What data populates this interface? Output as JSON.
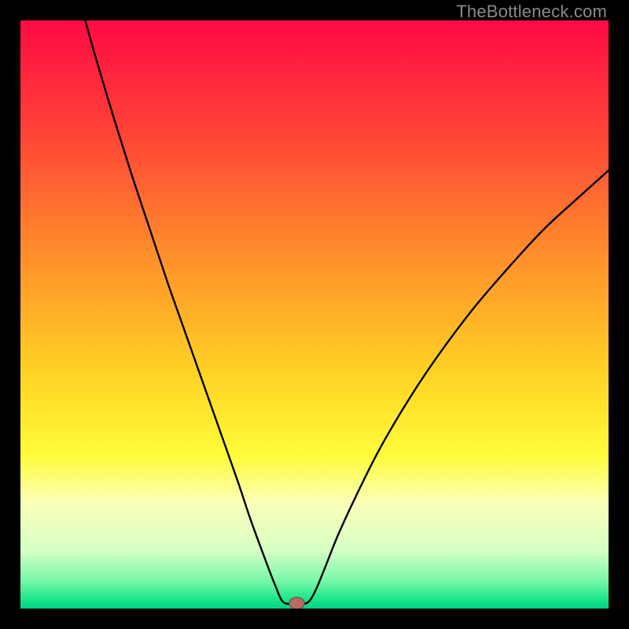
{
  "watermark": "TheBottleneck.com",
  "chart_data": {
    "type": "line",
    "title": "",
    "xlabel": "",
    "ylabel": "",
    "xlim": [
      0,
      100
    ],
    "ylim": [
      0,
      100
    ],
    "background_gradient": {
      "stops": [
        {
          "offset": 0.0,
          "color": "#ff0b44"
        },
        {
          "offset": 0.18,
          "color": "#ff3f37"
        },
        {
          "offset": 0.4,
          "color": "#ff8f2b"
        },
        {
          "offset": 0.6,
          "color": "#ffd324"
        },
        {
          "offset": 0.74,
          "color": "#fffc3a"
        },
        {
          "offset": 0.82,
          "color": "#faffb8"
        },
        {
          "offset": 0.9,
          "color": "#d7ffc4"
        },
        {
          "offset": 0.95,
          "color": "#7ef8ab"
        },
        {
          "offset": 0.985,
          "color": "#18e588"
        },
        {
          "offset": 1.0,
          "color": "#00d084"
        }
      ]
    },
    "series": [
      {
        "name": "bottleneck-curve",
        "color": "#000000",
        "stroke_width": 2.4,
        "points": [
          {
            "x": 11.0,
            "y": 100.0
          },
          {
            "x": 13.0,
            "y": 93.0
          },
          {
            "x": 16.0,
            "y": 83.0
          },
          {
            "x": 19.0,
            "y": 73.5
          },
          {
            "x": 22.0,
            "y": 64.5
          },
          {
            "x": 25.0,
            "y": 55.5
          },
          {
            "x": 28.0,
            "y": 47.0
          },
          {
            "x": 31.0,
            "y": 38.5
          },
          {
            "x": 34.0,
            "y": 30.0
          },
          {
            "x": 37.0,
            "y": 21.5
          },
          {
            "x": 39.0,
            "y": 15.5
          },
          {
            "x": 41.0,
            "y": 10.0
          },
          {
            "x": 42.5,
            "y": 6.0
          },
          {
            "x": 43.5,
            "y": 3.5
          },
          {
            "x": 44.3,
            "y": 1.6
          },
          {
            "x": 45.0,
            "y": 0.9
          },
          {
            "x": 46.0,
            "y": 0.8
          },
          {
            "x": 47.0,
            "y": 0.8
          },
          {
            "x": 48.0,
            "y": 0.8
          },
          {
            "x": 48.8,
            "y": 1.0
          },
          {
            "x": 49.5,
            "y": 1.8
          },
          {
            "x": 50.5,
            "y": 3.8
          },
          {
            "x": 52.0,
            "y": 7.5
          },
          {
            "x": 54.0,
            "y": 12.5
          },
          {
            "x": 57.0,
            "y": 19.0
          },
          {
            "x": 61.0,
            "y": 27.0
          },
          {
            "x": 66.0,
            "y": 35.5
          },
          {
            "x": 71.0,
            "y": 43.0
          },
          {
            "x": 77.0,
            "y": 51.0
          },
          {
            "x": 83.0,
            "y": 58.0
          },
          {
            "x": 89.0,
            "y": 64.5
          },
          {
            "x": 95.0,
            "y": 70.0
          },
          {
            "x": 100.0,
            "y": 74.5
          }
        ]
      }
    ],
    "marker": {
      "name": "optimal-point",
      "x": 47.0,
      "y": 0.9,
      "rx": 1.3,
      "ry": 1.0,
      "fill": "#b96a64",
      "stroke": "#7c3b36"
    }
  }
}
